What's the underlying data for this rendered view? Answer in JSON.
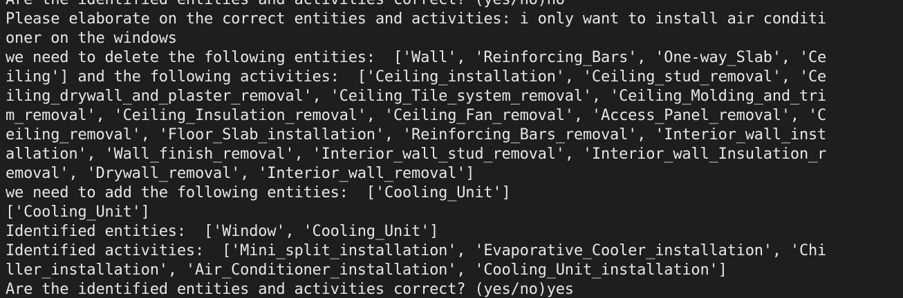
{
  "terminal": {
    "lines": [
      "Are the identified entities and activities correct? (yes/no)no",
      "Please elaborate on the correct entities and activities: i only want to install air conditi",
      "oner on the windows",
      "we need to delete the following entities:  ['Wall', 'Reinforcing_Bars', 'One-way_Slab', 'Ce",
      "iling'] and the following activities:  ['Ceiling_installation', 'Ceiling_stud_removal', 'Ce",
      "iling_drywall_and_plaster_removal', 'Ceiling_Tile_system_removal', 'Ceiling_Molding_and_tri",
      "m_removal', 'Ceiling_Insulation_removal', 'Ceiling_Fan_removal', 'Access_Panel_removal', 'C",
      "eiling_removal', 'Floor_Slab_installation', 'Reinforcing_Bars_removal', 'Interior_wall_inst",
      "allation', 'Wall_finish_removal', 'Interior_wall_stud_removal', 'Interior_wall_Insulation_r",
      "emoval', 'Drywall_removal', 'Interior_wall_removal']",
      "we need to add the following entities:  ['Cooling_Unit']",
      "['Cooling_Unit']",
      "Identified entities:  ['Window', 'Cooling_Unit']",
      "Identified activities:  ['Mini_split_installation', 'Evaporative_Cooler_installation', 'Chi",
      "ller_installation', 'Air_Conditioner_installation', 'Cooling_Unit_installation']",
      "Are the identified entities and activities correct? (yes/no)yes"
    ]
  }
}
